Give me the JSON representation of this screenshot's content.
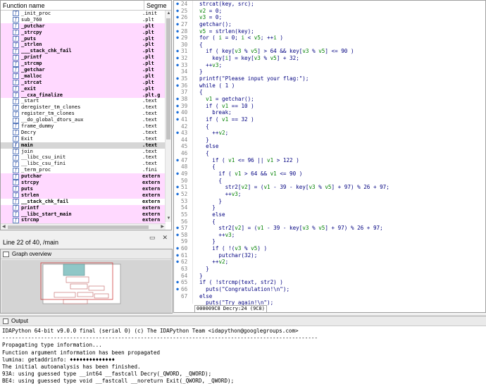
{
  "functions": {
    "col_name": "Function name",
    "col_segment": "Segme",
    "rows": [
      {
        "name": "_init_proc",
        "segment": ".init",
        "style": "plain"
      },
      {
        "name": "sub_760",
        "segment": ".plt",
        "style": "plain"
      },
      {
        "name": "_putchar",
        "segment": ".plt",
        "style": "lib"
      },
      {
        "name": "_strcpy",
        "segment": ".plt",
        "style": "lib"
      },
      {
        "name": "_puts",
        "segment": ".plt",
        "style": "lib"
      },
      {
        "name": "_strlen",
        "segment": ".plt",
        "style": "lib"
      },
      {
        "name": "___stack_chk_fail",
        "segment": ".plt",
        "style": "lib"
      },
      {
        "name": "_printf",
        "segment": ".plt",
        "style": "lib"
      },
      {
        "name": "_strcmp",
        "segment": ".plt",
        "style": "lib"
      },
      {
        "name": "_getchar",
        "segment": ".plt",
        "style": "lib"
      },
      {
        "name": "_malloc",
        "segment": ".plt",
        "style": "lib"
      },
      {
        "name": "_strcat",
        "segment": ".plt",
        "style": "lib"
      },
      {
        "name": "_exit",
        "segment": ".plt",
        "style": "lib"
      },
      {
        "name": "__cxa_finalize",
        "segment": ".plt.g",
        "style": "lib"
      },
      {
        "name": "_start",
        "segment": ".text",
        "style": "plain"
      },
      {
        "name": "deregister_tm_clones",
        "segment": ".text",
        "style": "plain"
      },
      {
        "name": "register_tm_clones",
        "segment": ".text",
        "style": "plain"
      },
      {
        "name": "__do_global_dtors_aux",
        "segment": ".text",
        "style": "plain"
      },
      {
        "name": "frame_dummy",
        "segment": ".text",
        "style": "plain"
      },
      {
        "name": "Decry",
        "segment": ".text",
        "style": "plain"
      },
      {
        "name": "Exit",
        "segment": ".text",
        "style": "plain"
      },
      {
        "name": "main",
        "segment": ".text",
        "style": "sel"
      },
      {
        "name": "join",
        "segment": ".text",
        "style": "plain"
      },
      {
        "name": "__libc_csu_init",
        "segment": ".text",
        "style": "plain"
      },
      {
        "name": "__libc_csu_fini",
        "segment": ".text",
        "style": "plain"
      },
      {
        "name": "_term_proc",
        "segment": ".fini",
        "style": "plain"
      },
      {
        "name": "putchar",
        "segment": "extern",
        "style": "lib"
      },
      {
        "name": "strcpy",
        "segment": "extern",
        "style": "lib"
      },
      {
        "name": "puts",
        "segment": "extern",
        "style": "lib"
      },
      {
        "name": "strlen",
        "segment": "extern",
        "style": "lib"
      },
      {
        "name": "__stack_chk_fail",
        "segment": "extern",
        "style": "ext"
      },
      {
        "name": "printf",
        "segment": "extern",
        "style": "lib"
      },
      {
        "name": "__libc_start_main",
        "segment": "extern",
        "style": "lib"
      },
      {
        "name": "strcmp",
        "segment": "extern",
        "style": "lib"
      }
    ]
  },
  "status": {
    "line_info": "Line 22 of 40, /main"
  },
  "graph_overview": {
    "title": "Graph overview"
  },
  "pseudocode": {
    "address_bar": "000009C8 Decry:24 (9C8)",
    "lines": [
      {
        "no": "24",
        "dot": true,
        "text": "strcat(key, src);"
      },
      {
        "no": "25",
        "dot": true,
        "text": "v2 = 0;"
      },
      {
        "no": "26",
        "dot": true,
        "text": "v3 = 0;"
      },
      {
        "no": "27",
        "dot": true,
        "text": "getchar();"
      },
      {
        "no": "28",
        "dot": true,
        "text": "v5 = strlen(key);"
      },
      {
        "no": "29",
        "dot": true,
        "text": "for ( i = 0; i < v5; ++i )"
      },
      {
        "no": "30",
        "dot": false,
        "text": "{"
      },
      {
        "no": "31",
        "dot": true,
        "text": "  if ( key[v3 % v5] > 64 && key[v3 % v5] <= 90 )"
      },
      {
        "no": "32",
        "dot": true,
        "text": "    key[i] = key[v3 % v5] + 32;"
      },
      {
        "no": "33",
        "dot": true,
        "text": "  ++v3;"
      },
      {
        "no": "34",
        "dot": false,
        "text": "}"
      },
      {
        "no": "35",
        "dot": true,
        "text": "printf(\"Please input your flag:\");"
      },
      {
        "no": "36",
        "dot": true,
        "text": "while ( 1 )"
      },
      {
        "no": "37",
        "dot": false,
        "text": "{"
      },
      {
        "no": "38",
        "dot": true,
        "text": "  v1 = getchar();"
      },
      {
        "no": "39",
        "dot": true,
        "text": "  if ( v1 == 10 )"
      },
      {
        "no": "40",
        "dot": true,
        "text": "    break;"
      },
      {
        "no": "41",
        "dot": true,
        "text": "  if ( v1 == 32 )"
      },
      {
        "no": "42",
        "dot": false,
        "text": "  {"
      },
      {
        "no": "43",
        "dot": true,
        "text": "    ++v2;"
      },
      {
        "no": "44",
        "dot": false,
        "text": "  }"
      },
      {
        "no": "45",
        "dot": false,
        "text": "  else"
      },
      {
        "no": "46",
        "dot": false,
        "text": "  {"
      },
      {
        "no": "47",
        "dot": true,
        "text": "    if ( v1 <= 96 || v1 > 122 )"
      },
      {
        "no": "48",
        "dot": false,
        "text": "    {"
      },
      {
        "no": "49",
        "dot": true,
        "text": "      if ( v1 > 64 && v1 <= 90 )"
      },
      {
        "no": "50",
        "dot": false,
        "text": "      {"
      },
      {
        "no": "51",
        "dot": true,
        "text": "        str2[v2] = (v1 - 39 - key[v3 % v5] + 97) % 26 + 97;"
      },
      {
        "no": "52",
        "dot": true,
        "text": "        ++v3;"
      },
      {
        "no": "53",
        "dot": false,
        "text": "      }"
      },
      {
        "no": "54",
        "dot": false,
        "text": "    }"
      },
      {
        "no": "55",
        "dot": false,
        "text": "    else"
      },
      {
        "no": "56",
        "dot": false,
        "text": "    {"
      },
      {
        "no": "57",
        "dot": true,
        "text": "      str2[v2] = (v1 - 39 - key[v3 % v5] + 97) % 26 + 97;"
      },
      {
        "no": "58",
        "dot": true,
        "text": "      ++v3;"
      },
      {
        "no": "59",
        "dot": false,
        "text": "    }"
      },
      {
        "no": "60",
        "dot": true,
        "text": "    if ( !(v3 % v5) )"
      },
      {
        "no": "61",
        "dot": true,
        "text": "      putchar(32);"
      },
      {
        "no": "62",
        "dot": true,
        "text": "    ++v2;"
      },
      {
        "no": "63",
        "dot": false,
        "text": "  }"
      },
      {
        "no": "64",
        "dot": false,
        "text": "}"
      },
      {
        "no": "65",
        "dot": true,
        "text": "if ( !strcmp(text, str2) )"
      },
      {
        "no": "66",
        "dot": true,
        "text": "  puts(\"Congratulation!\\n\");"
      },
      {
        "no": "67",
        "dot": false,
        "text": "else"
      },
      {
        "no": "",
        "dot": false,
        "text": "  puts(\"Try again!\\n\");"
      }
    ]
  },
  "output": {
    "title": "Output",
    "lines": [
      "IDAPython 64-bit v9.0.0 final (serial 0) (c) The IDAPython Team <idapython@googlegroups.com>",
      "--------------------------------------------------------------------------------------------------",
      "Propagating type information...",
      "Function argument information has been propagated",
      "lumina: getaddrinfo: ♦♦♦♦♦♦♦♦♦♦♦♦♦♦",
      "The initial autoanalysis has been finished.",
      "93A: using guessed type __int64 __fastcall Decry(_QWORD, _QWORD);",
      "BE4: using guessed type void __fastcall __noreturn Exit(_QWORD, _QWORD);"
    ]
  }
}
